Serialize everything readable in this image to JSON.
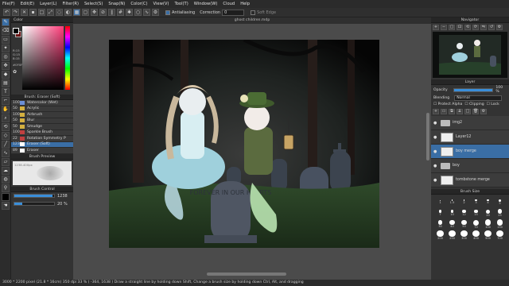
{
  "menu": [
    "File(F)",
    "Edit(E)",
    "Layer(L)",
    "Filter(R)",
    "Select(S)",
    "Snap(N)",
    "Color(C)",
    "View(V)",
    "Tool(T)",
    "Window(W)",
    "Cloud",
    "Help"
  ],
  "toolbar": {
    "antialias_label": "Antialiasing",
    "correction_label": "Correction",
    "correction_value": "0",
    "soft_edge_label": "Soft Edge"
  },
  "color_panel": {
    "title": "Color",
    "r": "R:15",
    "g": "G:15",
    "b": "B:15",
    "hex": "#0F0F0F"
  },
  "brush_panel": {
    "title": "Brush: Eraser (Soft)",
    "items": [
      {
        "size": "100",
        "name": "Watercolor (Wet)",
        "color": "#6b8fd6"
      },
      {
        "size": "50",
        "name": "Acrylic",
        "color": "#d4b040"
      },
      {
        "size": "100",
        "name": "Airbrush",
        "color": "#d4b040"
      },
      {
        "size": "50",
        "name": "Blur",
        "color": "#d4b040"
      },
      {
        "size": "50",
        "name": "Smudge",
        "color": "#d4b040"
      },
      {
        "size": "100",
        "name": "Sparkle Brush",
        "color": "#c04040"
      },
      {
        "size": "22",
        "name": "Rotation Symmetry P",
        "color": "#c04040"
      },
      {
        "size": "1238",
        "name": "Eraser (Soft)",
        "color": "#ffffff"
      },
      {
        "size": "89",
        "name": "Eraser",
        "color": "#ffffff"
      }
    ],
    "selected_index": 7
  },
  "brush_preview": {
    "title": "Brush Preview",
    "size_label": "1238.400px"
  },
  "brush_control": {
    "title": "Brush Control",
    "size_value": "1238",
    "opacity_value": "20 %",
    "size_fraction": 0.95,
    "opacity_fraction": 0.2
  },
  "document": {
    "title": "ghost children.mdp"
  },
  "navigator": {
    "title": "Navigator"
  },
  "layer_panel": {
    "title": "Layer",
    "opacity_label": "Opacity",
    "opacity_value": "100 %",
    "blending_label": "Blending",
    "blending_value": "Normal",
    "protect_alpha": "Protect Alpha",
    "clipping": "Clipping",
    "lock": "Lock",
    "layers": [
      {
        "name": "img2",
        "type": "folder"
      },
      {
        "name": "Layer12",
        "type": "layer"
      },
      {
        "name": "boy merge",
        "type": "layer"
      },
      {
        "name": "boy",
        "type": "folder"
      },
      {
        "name": "tombstone merge",
        "type": "layer"
      }
    ],
    "selected_index": 2
  },
  "brush_size_panel": {
    "title": "Brush Size",
    "sizes": [
      "1",
      "1.5",
      "2",
      "3",
      "4",
      "5",
      "7",
      "10",
      "12",
      "15",
      "20",
      "25",
      "30",
      "40",
      "50",
      "70",
      "100",
      "150",
      "200",
      "250",
      "300",
      "400",
      "500",
      "700",
      "1000",
      "1500"
    ]
  },
  "tombstone_text": "FOREVER IN OUR HEARTS",
  "status": {
    "text": "3000 * 2200 pixel   (21.8 * 16cm)   350 dpi   33 %   ( -364, 1638 )   Draw a straight line by holding down Shift, Change a brush size by holding down Ctrl, Alt, and dragging"
  }
}
